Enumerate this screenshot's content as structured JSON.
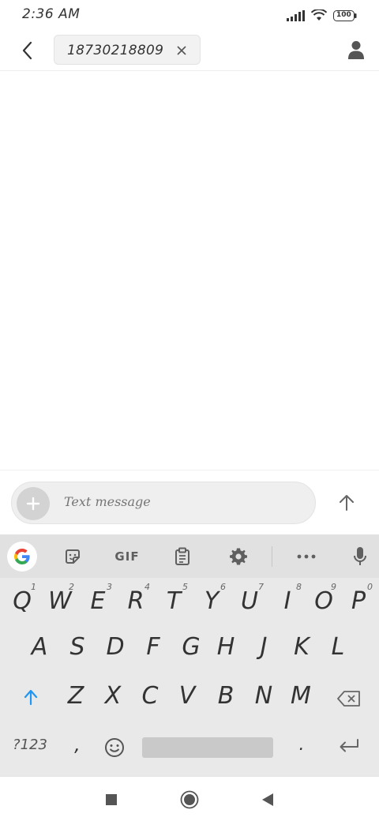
{
  "status_bar": {
    "time": "2:36 AM",
    "battery": "100"
  },
  "header": {
    "recipient": "18730218809",
    "icons": {
      "back": "back-arrow-icon",
      "close": "close-icon",
      "contact": "person-icon"
    }
  },
  "compose": {
    "placeholder": "Text message",
    "icons": {
      "add": "plus-icon",
      "send": "send-arrow-icon"
    }
  },
  "keyboard": {
    "toolbar": {
      "gif_label": "GIF",
      "icons": [
        "google-icon",
        "sticker-icon",
        "gif-icon",
        "clipboard-icon",
        "gear-icon",
        "more-icon",
        "microphone-icon"
      ]
    },
    "row1": [
      {
        "k": "Q",
        "h": "1"
      },
      {
        "k": "W",
        "h": "2"
      },
      {
        "k": "E",
        "h": "3"
      },
      {
        "k": "R",
        "h": "4"
      },
      {
        "k": "T",
        "h": "5"
      },
      {
        "k": "Y",
        "h": "6"
      },
      {
        "k": "U",
        "h": "7"
      },
      {
        "k": "I",
        "h": "8"
      },
      {
        "k": "O",
        "h": "9"
      },
      {
        "k": "P",
        "h": "0"
      }
    ],
    "row2": [
      "A",
      "S",
      "D",
      "F",
      "G",
      "H",
      "J",
      "K",
      "L"
    ],
    "row3": [
      "Z",
      "X",
      "C",
      "V",
      "B",
      "N",
      "M"
    ],
    "symbols_label": "?123",
    "comma": ",",
    "period": "."
  },
  "accent_color": "#2196F3"
}
